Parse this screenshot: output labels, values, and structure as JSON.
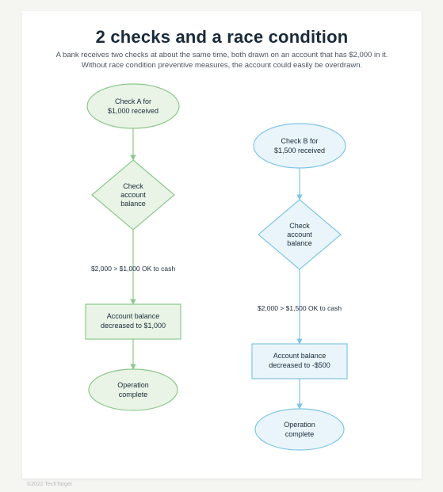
{
  "title": "2 checks and a race condition",
  "subtitle": "A bank receives two checks at about the same time, both drawn on an account that has $2,000 in it. Without race condition preventive measures, the account could easily be overdrawn.",
  "footer": "©2022 TechTarget",
  "colors": {
    "greenStroke": "#8cc78c",
    "greenFill": "#e9f4e6",
    "blueStroke": "#7fc5e6",
    "blueFill": "#eaf5fb"
  },
  "flowA": {
    "start1": "Check A for",
    "start2": "$1,000 received",
    "decision1": "Check",
    "decision2": "account",
    "decision3": "balance",
    "anno": "$2,000 > $1,000 OK to cash",
    "proc1": "Account balance",
    "proc2": "decreased to $1,000",
    "end1": "Operation",
    "end2": "complete"
  },
  "flowB": {
    "start1": "Check B for",
    "start2": "$1,500 received",
    "decision1": "Check",
    "decision2": "account",
    "decision3": "balance",
    "anno": "$2,000 > $1,500 OK to cash",
    "proc1": "Account balance",
    "proc2": "decreased to -$500",
    "end1": "Operation",
    "end2": "complete"
  }
}
